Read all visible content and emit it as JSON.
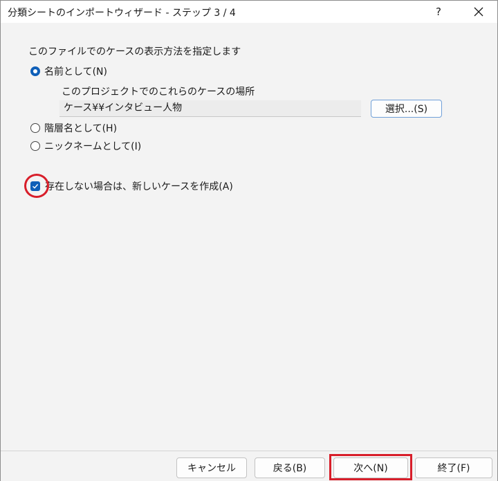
{
  "window": {
    "title": "分類シートのインポートウィザード - ステップ 3 / 4",
    "help_label": "?",
    "close_icon": "close-icon"
  },
  "main": {
    "heading": "このファイルでのケースの表示方法を指定します",
    "options": [
      {
        "label": "名前として(N)",
        "checked": true
      },
      {
        "label": "階層名として(H)",
        "checked": false
      },
      {
        "label": "ニックネームとして(I)",
        "checked": false
      }
    ],
    "location_label": "このプロジェクトでのこれらのケースの場所",
    "location_value": "ケース¥¥インタビュー人物",
    "select_button": "選択...(S)",
    "create_checkbox": {
      "label": "存在しない場合は、新しいケースを作成(A)",
      "checked": true
    }
  },
  "footer": {
    "cancel": "キャンセル",
    "back": "戻る(B)",
    "next": "次へ(N)",
    "finish": "終了(F)"
  },
  "colors": {
    "accent": "#0f5fb8",
    "highlight": "#d81e2a"
  }
}
